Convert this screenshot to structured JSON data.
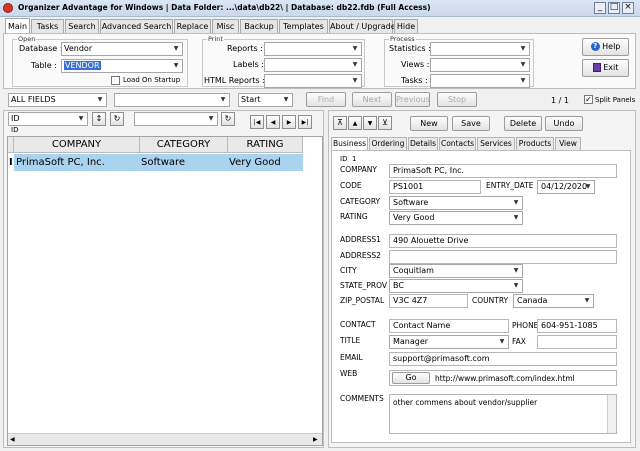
{
  "window": {
    "title": "Organizer Advantage for Windows | Data Folder: ...\\data\\db22\\ | Database: db22.fdb (Full Access)",
    "controls": [
      "_",
      "□",
      "×"
    ]
  },
  "main_tabs": [
    "Main",
    "Tasks",
    "Search",
    "Advanced Search",
    "Replace",
    "Misc",
    "Backup",
    "Templates",
    "About / Upgrade",
    "Hide"
  ],
  "open_group": {
    "label": "Open",
    "database_label": "Database :",
    "database_value": "Vendor",
    "table_label": "Table :",
    "table_value": "VENDOR",
    "load_on_startup": "Load On Startup"
  },
  "print_group": {
    "label": "Print",
    "reports_label": "Reports :",
    "labels_label": "Labels :",
    "html_reports_label": "HTML Reports :"
  },
  "process_group": {
    "label": "Process",
    "statistics_label": "Statistics :",
    "views_label": "Views :",
    "tasks_label": "Tasks :"
  },
  "help_button": "Help",
  "exit_button": "Exit",
  "searchbar": {
    "field": "ALL FIELDS",
    "mode": "Start",
    "find": "Find",
    "next": "Next",
    "previous": "Previous",
    "stop": "Stop",
    "record_counter": "1 / 1",
    "split_panels": "Split Panels"
  },
  "sort": {
    "field": "ID",
    "sub": "ID",
    "sort_icon": "↕",
    "refresh_icon": "↻"
  },
  "nav": {
    "first": "|◀",
    "prev": "◀",
    "next": "▶",
    "last": "▶|"
  },
  "grid": {
    "columns": [
      "COMPANY",
      "CATEGORY",
      "RATING"
    ],
    "rows": [
      {
        "marker": "I",
        "company": "PrimaSoft PC, Inc.",
        "category": "Software",
        "rating": "Very Good"
      }
    ]
  },
  "record_toolbar": {
    "first": "⊼",
    "up": "▲",
    "down": "▼",
    "last": "⊻",
    "new": "New",
    "save": "Save",
    "delete": "Delete",
    "undo": "Undo"
  },
  "detail_tabs": [
    "Business",
    "Ordering",
    "Details",
    "Contacts",
    "Services",
    "Products",
    "View"
  ],
  "record": {
    "id_label": "ID",
    "id_value": "1",
    "company_label": "COMPANY",
    "company": "PrimaSoft PC, Inc.",
    "code_label": "CODE",
    "code": "PS1001",
    "entry_date_label": "ENTRY_DATE",
    "entry_date": "04/12/2020",
    "category_label": "CATEGORY",
    "category": "Software",
    "rating_label": "RATING",
    "rating": "Very Good",
    "address1_label": "ADDRESS1",
    "address1": "490 Alouette Drive",
    "address2_label": "ADDRESS2",
    "address2": "",
    "city_label": "CITY",
    "city": "Coquitlam",
    "state_label": "STATE_PROV",
    "state": "BC",
    "zip_label": "ZIP_POSTAL",
    "zip": "V3C 4Z7",
    "country_label": "COUNTRY",
    "country": "Canada",
    "contact_label": "CONTACT",
    "contact": "Contact Name",
    "phone_label": "PHONE",
    "phone": "604-951-1085",
    "title_label": "TITLE",
    "title": "Manager",
    "fax_label": "FAX",
    "fax": "",
    "email_label": "EMAIL",
    "email": "support@primasoft.com",
    "web_label": "WEB",
    "web_go": "Go",
    "web": "http://www.primasoft.com/index.html",
    "comments_label": "COMMENTS",
    "comments": "other commens about vendor/supplier"
  }
}
